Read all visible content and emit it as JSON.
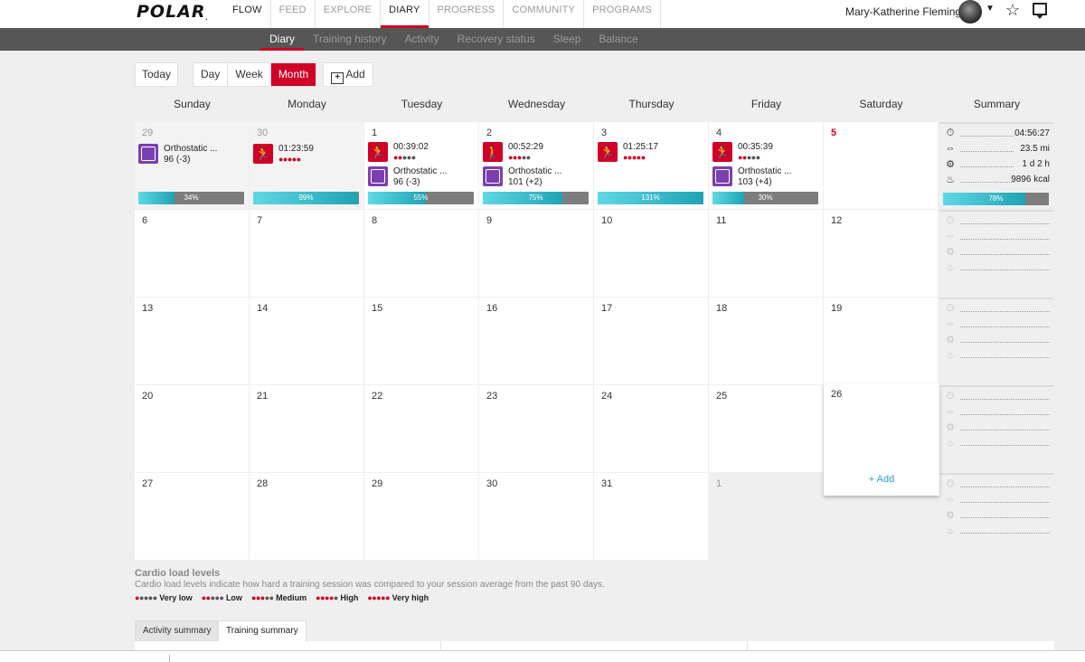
{
  "brand": {
    "logo": "POLAR"
  },
  "nav": {
    "items": [
      "FLOW",
      "FEED",
      "EXPLORE",
      "DIARY",
      "PROGRESS",
      "COMMUNITY",
      "PROGRAMS"
    ],
    "active": "DIARY"
  },
  "user": {
    "name": "Mary-Katherine Fleming"
  },
  "subnav": {
    "items": [
      "Diary",
      "Training history",
      "Activity",
      "Recovery status",
      "Sleep",
      "Balance"
    ],
    "active": "Diary"
  },
  "toolbar": {
    "today_label": "Today",
    "views": [
      "Day",
      "Week",
      "Month"
    ],
    "active_view": "Month",
    "add_label": "Add"
  },
  "calendar": {
    "headers": [
      "Sunday",
      "Monday",
      "Tuesday",
      "Wednesday",
      "Thursday",
      "Friday",
      "Saturday",
      "Summary"
    ],
    "today_day": "5",
    "week1": [
      {
        "day": "29",
        "ortho_label": "Orthostatic ...",
        "ortho_value": "96 (-3)",
        "bar_pct": "34%",
        "bar_fill": 0.34
      },
      {
        "day": "30",
        "training_time": "01:23:59",
        "load_level": 5,
        "bar_pct": "99%",
        "bar_fill": 0.99
      },
      {
        "day": "1",
        "training_time": "00:39:02",
        "load_level": 2,
        "ortho_label": "Orthostatic ...",
        "ortho_value": "96 (-3)",
        "bar_pct": "55%",
        "bar_fill": 0.55
      },
      {
        "day": "2",
        "training_time": "00:52:29",
        "load_level": 3,
        "ortho_label": "Orthostatic ...",
        "ortho_value": "101 (+2)",
        "bar_pct": "75%",
        "bar_fill": 0.75
      },
      {
        "day": "3",
        "training_time": "01:25:17",
        "load_level": 5,
        "bar_pct": "131%",
        "bar_fill": 1.0
      },
      {
        "day": "4",
        "training_time": "00:35:39",
        "load_level": 2,
        "ortho_label": "Orthostatic ...",
        "ortho_value": "103 (+4)",
        "bar_pct": "30%",
        "bar_fill": 0.3
      },
      {
        "day": "5"
      }
    ],
    "week1_summary": {
      "duration": "04:56:27",
      "distance": "23.5 mi",
      "ascent": "1 d 2 h",
      "calories": "9896 kcal",
      "bar_pct": "78%",
      "bar_fill": 0.78
    },
    "week2": [
      "6",
      "7",
      "8",
      "9",
      "10",
      "11",
      "12"
    ],
    "week3": [
      "13",
      "14",
      "15",
      "16",
      "17",
      "18",
      "19"
    ],
    "week4": [
      "20",
      "21",
      "22",
      "23",
      "24",
      "25",
      "26"
    ],
    "week5": [
      "27",
      "28",
      "29",
      "30",
      "31",
      "1",
      ""
    ],
    "add_link": "+ Add"
  },
  "legend": {
    "title": "Cardio load levels",
    "description": "Cardio load levels indicate how hard a training session was compared to your session average from the past 90 days.",
    "levels": [
      {
        "label": "Very low",
        "filled": 1
      },
      {
        "label": "Low",
        "filled": 2
      },
      {
        "label": "Medium",
        "filled": 3
      },
      {
        "label": "High",
        "filled": 4
      },
      {
        "label": "Very high",
        "filled": 5
      }
    ]
  },
  "bottom_tabs": {
    "activity": "Activity summary",
    "training": "Training summary"
  },
  "colors": {
    "accent": "#d10027",
    "ortho": "#7a3fb0",
    "bar": "#1fa3b4"
  }
}
